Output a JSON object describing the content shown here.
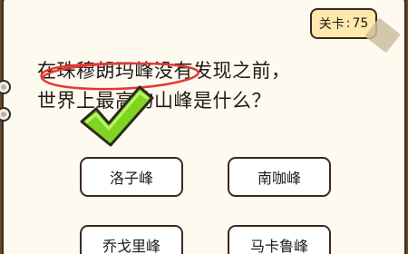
{
  "level": {
    "label": "关卡",
    "separator": ":",
    "number": "75"
  },
  "question": {
    "line1": "在珠穆朗玛峰没有发现之前，",
    "line2": "世界上最高的山峰是什么？"
  },
  "options": [
    {
      "label": "洛子峰"
    },
    {
      "label": "南咖峰"
    },
    {
      "label": "乔戈里峰"
    },
    {
      "label": "马卡鲁峰"
    }
  ],
  "colors": {
    "paper": "#fffaf0",
    "badge": "#ffe8ad",
    "circle_mark": "#e23b33",
    "check_mark": "#7fd321"
  },
  "icons": {
    "check": "check-mark-icon",
    "ring": "binder-ring-icon"
  }
}
